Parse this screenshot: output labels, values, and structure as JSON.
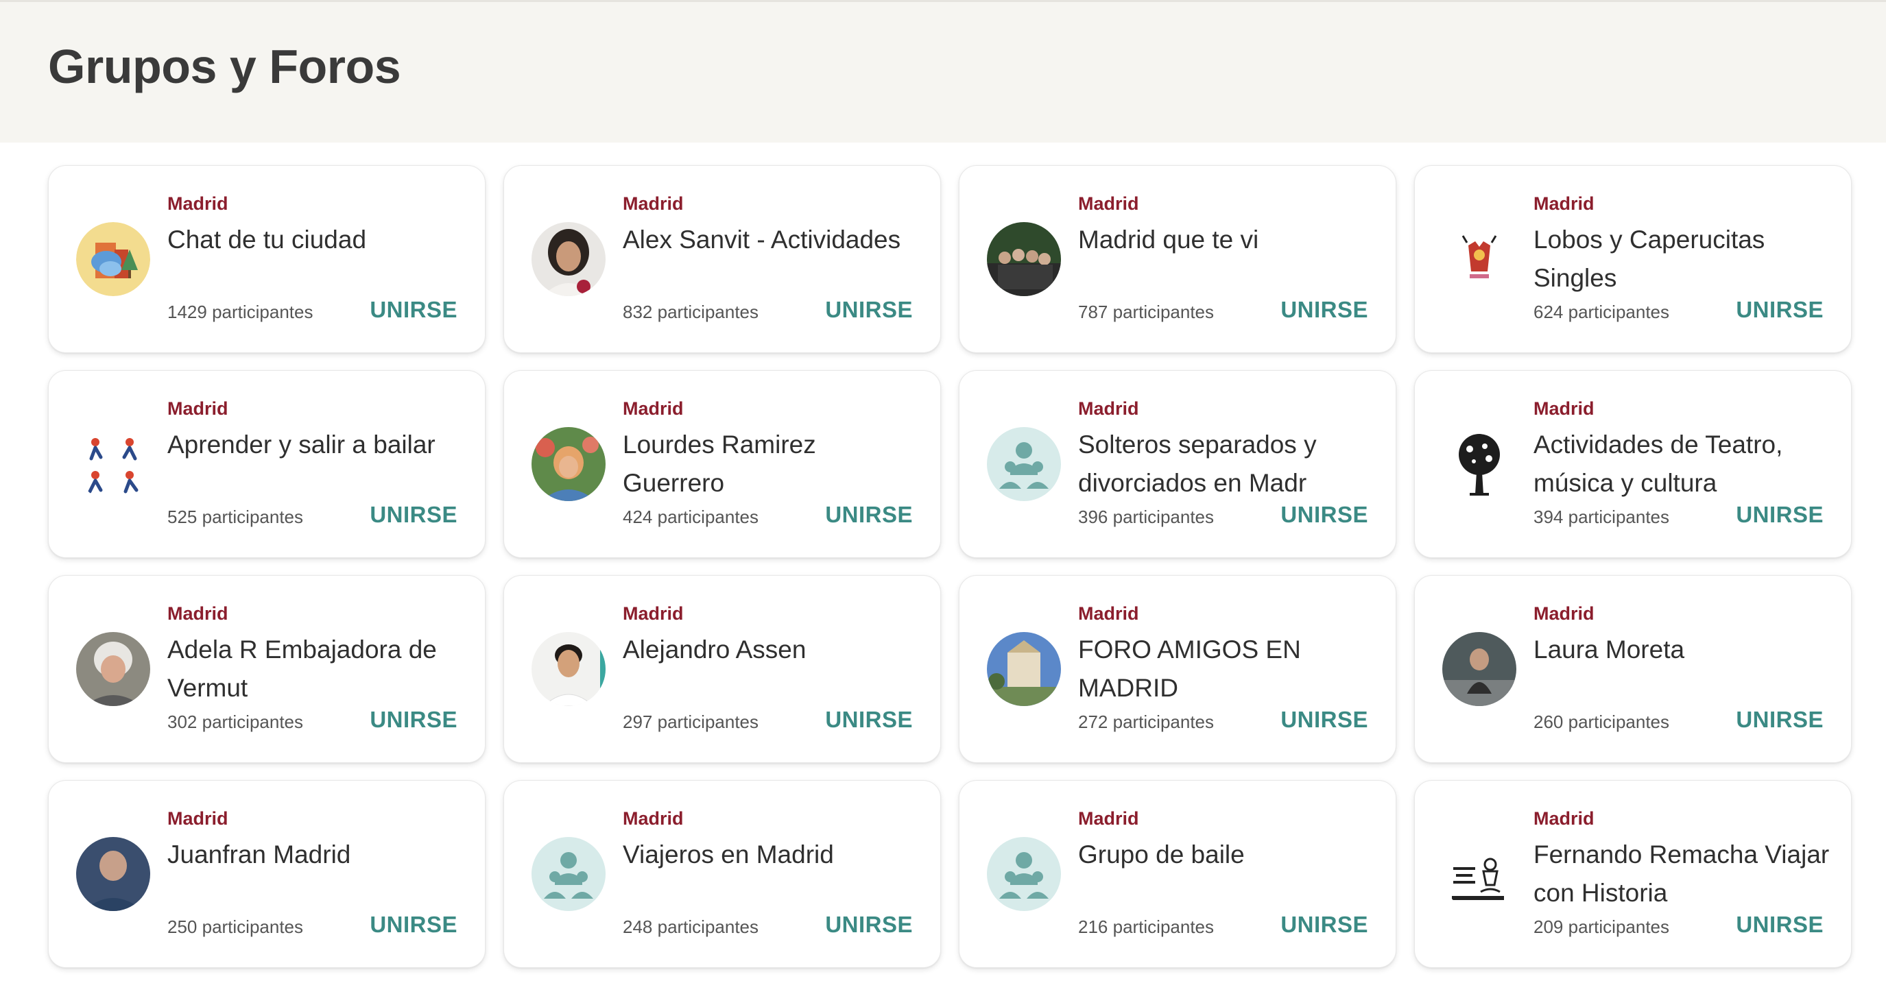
{
  "page": {
    "title": "Grupos y Foros"
  },
  "colors": {
    "city": "#8b1e2d",
    "join": "#3b8a84",
    "header_bg": "#f6f5f1",
    "placeholder": "#d7ebea",
    "placeholder_fg": "#6fa9a5"
  },
  "groups": [
    {
      "city": "Madrid",
      "name": "Chat de tu ciudad",
      "count": "1429 participantes",
      "join": "UNIRSE",
      "avatar": "chat-city-icon"
    },
    {
      "city": "Madrid",
      "name": "Alex Sanvit - Actividades",
      "count": "832 participantes",
      "join": "UNIRSE",
      "avatar": "photo"
    },
    {
      "city": "Madrid",
      "name": "Madrid que te vi",
      "count": "787 participantes",
      "join": "UNIRSE",
      "avatar": "photo"
    },
    {
      "city": "Madrid",
      "name": "Lobos y Caperucitas Singles",
      "count": "624 participantes",
      "join": "UNIRSE",
      "avatar": "logo"
    },
    {
      "city": "Madrid",
      "name": "Aprender y salir a bailar",
      "count": "525 participantes",
      "join": "UNIRSE",
      "avatar": "dance-icon"
    },
    {
      "city": "Madrid",
      "name": "Lourdes Ramirez Guerrero",
      "count": "424 participantes",
      "join": "UNIRSE",
      "avatar": "photo"
    },
    {
      "city": "Madrid",
      "name": "Solteros separados y divorciados en Madr",
      "count": "396 participantes",
      "join": "UNIRSE",
      "avatar": "group-placeholder-icon"
    },
    {
      "city": "Madrid",
      "name": "Actividades de Teatro, música y cultura",
      "count": "394 participantes",
      "join": "UNIRSE",
      "avatar": "tree-icon"
    },
    {
      "city": "Madrid",
      "name": "Adela R Embajadora de Vermut",
      "count": "302 participantes",
      "join": "UNIRSE",
      "avatar": "photo"
    },
    {
      "city": "Madrid",
      "name": "Alejandro Assen",
      "count": "297 participantes",
      "join": "UNIRSE",
      "avatar": "photo"
    },
    {
      "city": "Madrid",
      "name": "FORO AMIGOS EN MADRID",
      "count": "272 participantes",
      "join": "UNIRSE",
      "avatar": "photo"
    },
    {
      "city": "Madrid",
      "name": "Laura Moreta",
      "count": "260 participantes",
      "join": "UNIRSE",
      "avatar": "photo"
    },
    {
      "city": "Madrid",
      "name": "Juanfran Madrid",
      "count": "250 participantes",
      "join": "UNIRSE",
      "avatar": "photo"
    },
    {
      "city": "Madrid",
      "name": "Viajeros en Madrid",
      "count": "248 participantes",
      "join": "UNIRSE",
      "avatar": "group-placeholder-icon"
    },
    {
      "city": "Madrid",
      "name": "Grupo de baile",
      "count": "216 participantes",
      "join": "UNIRSE",
      "avatar": "group-placeholder-icon"
    },
    {
      "city": "Madrid",
      "name": "Fernando Remacha Viajar con Historia",
      "count": "209 participantes",
      "join": "UNIRSE",
      "avatar": "logo"
    }
  ]
}
